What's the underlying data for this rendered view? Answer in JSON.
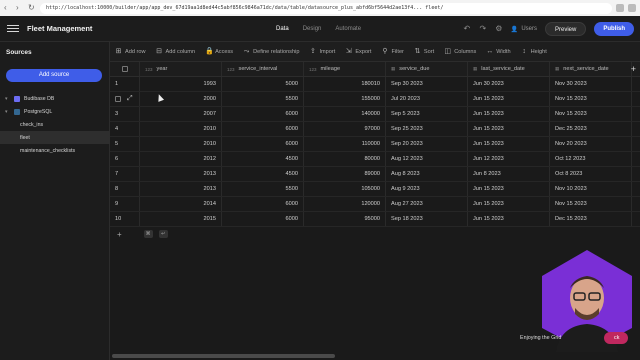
{
  "browser": {
    "url": "http://localhost:10000/builder/app/app_dev_67d19aa1d8ed44c5abf856c9846a71dc/data/table/datasource_plus_abfd6bf5644d2ae13f4... fleet/"
  },
  "app": {
    "title": "Fleet Management",
    "tabs": [
      {
        "label": "Data",
        "active": true
      },
      {
        "label": "Design",
        "active": false
      },
      {
        "label": "Automate",
        "active": false
      }
    ],
    "users_label": "Users",
    "preview_label": "Preview",
    "publish_label": "Publish"
  },
  "sidebar": {
    "title": "Sources",
    "add_source_label": "Add source",
    "items": [
      {
        "label": "Budibase DB",
        "level": 0,
        "icon": "budibase-db-icon",
        "color": "#6c6cf2"
      },
      {
        "label": "PostgreSQL",
        "level": 0,
        "icon": "postgresql-icon",
        "color": "#336791"
      },
      {
        "label": "check_ins",
        "level": 1
      },
      {
        "label": "fleet",
        "level": 1,
        "selected": true
      },
      {
        "label": "maintenance_checklists",
        "level": 1
      }
    ]
  },
  "toolbar": {
    "items": [
      {
        "label": "Add row",
        "icon": "add-row-icon",
        "glyph": "⊞"
      },
      {
        "label": "Add column",
        "icon": "add-column-icon",
        "glyph": "⊟"
      },
      {
        "label": "Access",
        "icon": "lock-icon",
        "glyph": "🔒"
      },
      {
        "label": "Define relationship",
        "icon": "relationship-icon",
        "glyph": "⤳"
      },
      {
        "label": "Import",
        "icon": "import-icon",
        "glyph": "⇪"
      },
      {
        "label": "Export",
        "icon": "export-icon",
        "glyph": "⇲"
      },
      {
        "label": "Filter",
        "icon": "filter-icon",
        "glyph": "⚲"
      },
      {
        "label": "Sort",
        "icon": "sort-icon",
        "glyph": "⇅"
      },
      {
        "label": "Columns",
        "icon": "columns-icon",
        "glyph": "◫"
      },
      {
        "label": "Width",
        "icon": "width-icon",
        "glyph": "↔"
      },
      {
        "label": "Height",
        "icon": "height-icon",
        "glyph": "↕"
      }
    ]
  },
  "table": {
    "columns": [
      {
        "label": "year",
        "type": "number",
        "type_label": "123"
      },
      {
        "label": "service_interval",
        "type": "number",
        "type_label": "123"
      },
      {
        "label": "mileage",
        "type": "number",
        "type_label": "123"
      },
      {
        "label": "service_due",
        "type": "date",
        "type_label": "▦"
      },
      {
        "label": "last_service_date",
        "type": "date",
        "type_label": "▦"
      },
      {
        "label": "next_service_date",
        "type": "date",
        "type_label": "▦"
      }
    ],
    "rows": [
      {
        "n": "1",
        "year": "1993",
        "service_interval": "5000",
        "mileage": "180010",
        "service_due": "Sep 30 2023",
        "last_service_date": "Jun 30 2023",
        "next_service_date": "Nov 30 2023"
      },
      {
        "n": "2",
        "year": "2000",
        "service_interval": "5500",
        "mileage": "155000",
        "service_due": "Jul 20 2023",
        "last_service_date": "Jun 15 2023",
        "next_service_date": "Nov 15 2023"
      },
      {
        "n": "3",
        "year": "2007",
        "service_interval": "6000",
        "mileage": "140000",
        "service_due": "Sep 5 2023",
        "last_service_date": "Jun 15 2023",
        "next_service_date": "Nov 15 2023"
      },
      {
        "n": "4",
        "year": "2010",
        "service_interval": "6000",
        "mileage": "97000",
        "service_due": "Sep 25 2023",
        "last_service_date": "Jun 15 2023",
        "next_service_date": "Dec 25 2023"
      },
      {
        "n": "5",
        "year": "2010",
        "service_interval": "6000",
        "mileage": "110000",
        "service_due": "Sep 20 2023",
        "last_service_date": "Jun 15 2023",
        "next_service_date": "Nov 20 2023"
      },
      {
        "n": "6",
        "year": "2012",
        "service_interval": "4500",
        "mileage": "80000",
        "service_due": "Aug 12 2023",
        "last_service_date": "Jun 12 2023",
        "next_service_date": "Oct 12 2023"
      },
      {
        "n": "7",
        "year": "2013",
        "service_interval": "4500",
        "mileage": "89000",
        "service_due": "Aug 8 2023",
        "last_service_date": "Jun 8 2023",
        "next_service_date": "Oct 8 2023"
      },
      {
        "n": "8",
        "year": "2013",
        "service_interval": "5500",
        "mileage": "105000",
        "service_due": "Aug 9 2023",
        "last_service_date": "Jun 15 2023",
        "next_service_date": "Nov 10 2023"
      },
      {
        "n": "9",
        "year": "2014",
        "service_interval": "6000",
        "mileage": "120000",
        "service_due": "Aug 27 2023",
        "last_service_date": "Jun 15 2023",
        "next_service_date": "Nov 15 2023"
      },
      {
        "n": "10",
        "year": "2015",
        "service_interval": "6000",
        "mileage": "95000",
        "service_due": "Sep 18 2023",
        "last_service_date": "Jun 15 2023",
        "next_service_date": "Dec 15 2023"
      }
    ],
    "add_row_shortcut": [
      "⌘",
      "↵"
    ]
  },
  "overlay": {
    "toast_text": "Enjoying the Grid",
    "toast_button": "ck",
    "hex_color": "#7a2fd6"
  }
}
